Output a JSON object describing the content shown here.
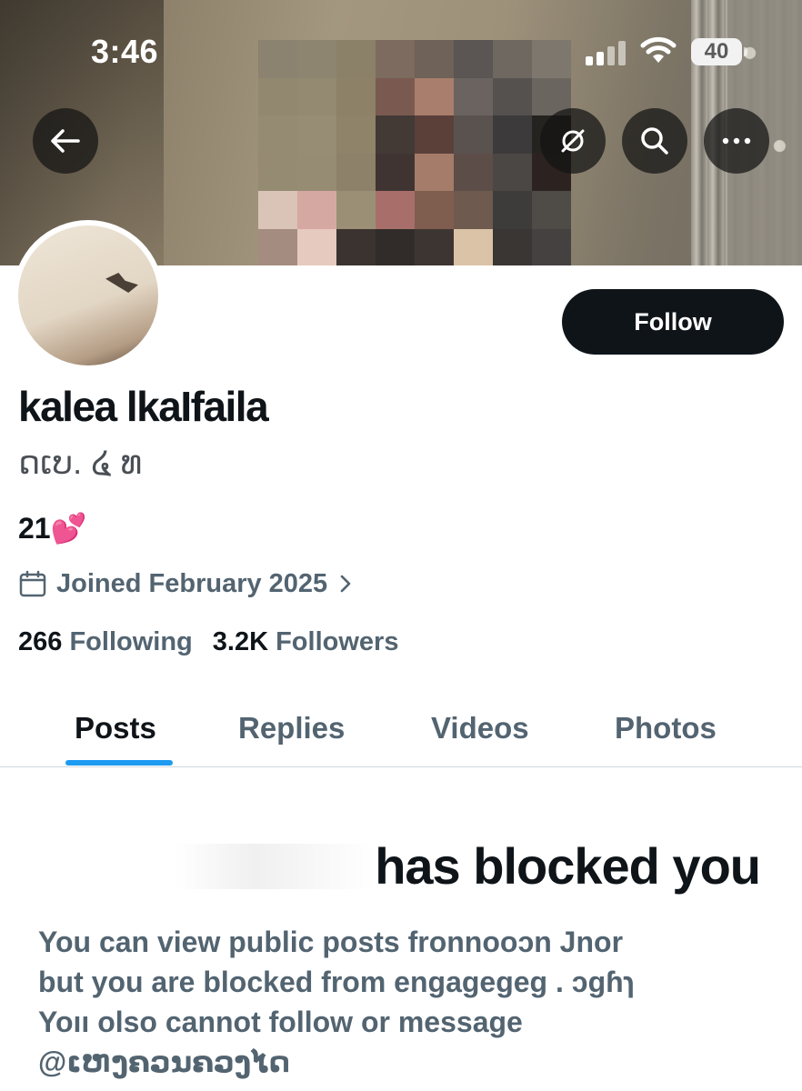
{
  "status_bar": {
    "time": "3:46",
    "battery": "40"
  },
  "header": {
    "back_icon": "back-arrow-icon",
    "grok_icon": "grok-icon",
    "search_icon": "search-icon",
    "more_icon": "more-icon"
  },
  "profile": {
    "display_name": "kalea lkaIfaila",
    "handle": "ດເບ. ໔ ທ",
    "bio": "21💕",
    "joined": "Joined February 2025",
    "following_count": "266",
    "following_label": "Following",
    "followers_count": "3.2K",
    "followers_label": "Followers",
    "follow_label": "Follow"
  },
  "tabs": [
    {
      "label": "Posts",
      "active": true
    },
    {
      "label": "Replies",
      "active": false
    },
    {
      "label": "Videos",
      "active": false
    },
    {
      "label": "Photos",
      "active": false
    }
  ],
  "blocked": {
    "title": "has blocked you",
    "line1": "You can view public posts fronnooɔn Jnor",
    "line2": "but you are blocked from engagegeg . ɔɡɦɿ",
    "line3": "Yoıı olso cannot follow or message",
    "line4": "@ເຫງຄວນຄວງໄດ"
  },
  "colors": {
    "primary_text": "#0f1419",
    "secondary_text": "#536471",
    "accent": "#1d9bf0",
    "follow_button": "#0f1419"
  }
}
